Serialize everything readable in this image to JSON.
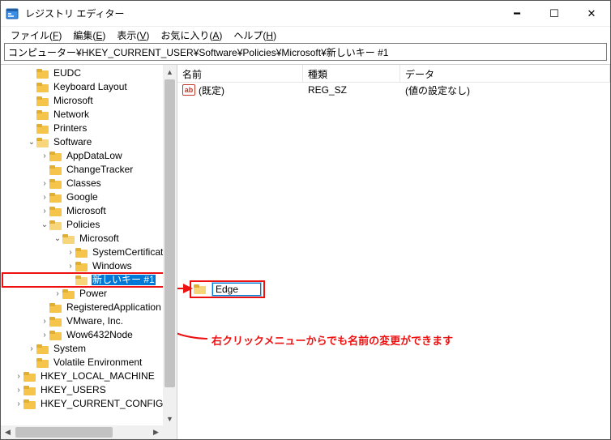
{
  "window": {
    "title": "レジストリ エディター"
  },
  "menubar": [
    {
      "label": "ファイル(F)",
      "key": "F"
    },
    {
      "label": "編集(E)",
      "key": "E"
    },
    {
      "label": "表示(V)",
      "key": "V"
    },
    {
      "label": "お気に入り(A)",
      "key": "A"
    },
    {
      "label": "ヘルプ(H)",
      "key": "H"
    }
  ],
  "path": "コンピューター¥HKEY_CURRENT_USER¥Software¥Policies¥Microsoft¥新しいキー #1",
  "list": {
    "cols": {
      "name": "名前",
      "type": "種類",
      "data": "データ"
    },
    "rows": [
      {
        "name": "(既定)",
        "type": "REG_SZ",
        "data": "(値の設定なし)"
      }
    ]
  },
  "callout": {
    "value": "Edge"
  },
  "annotation_text": "右クリックメニューからでも名前の変更ができます",
  "tree": [
    {
      "d": 0,
      "t": "none",
      "label": "EUDC"
    },
    {
      "d": 0,
      "t": "none",
      "label": "Keyboard Layout"
    },
    {
      "d": 0,
      "t": "none",
      "label": "Microsoft"
    },
    {
      "d": 0,
      "t": "none",
      "label": "Network"
    },
    {
      "d": 0,
      "t": "none",
      "label": "Printers"
    },
    {
      "d": 0,
      "t": "open",
      "label": "Software"
    },
    {
      "d": 1,
      "t": "closed",
      "label": "AppDataLow"
    },
    {
      "d": 1,
      "t": "none",
      "label": "ChangeTracker"
    },
    {
      "d": 1,
      "t": "closed",
      "label": "Classes"
    },
    {
      "d": 1,
      "t": "closed",
      "label": "Google"
    },
    {
      "d": 1,
      "t": "closed",
      "label": "Microsoft"
    },
    {
      "d": 1,
      "t": "open",
      "label": "Policies"
    },
    {
      "d": 2,
      "t": "open",
      "label": "Microsoft"
    },
    {
      "d": 3,
      "t": "closed",
      "label": "SystemCertificat"
    },
    {
      "d": 3,
      "t": "closed",
      "label": "Windows"
    },
    {
      "d": 3,
      "t": "sel",
      "label": "新しいキー #1"
    },
    {
      "d": 2,
      "t": "closed",
      "label": "Power"
    },
    {
      "d": 1,
      "t": "none",
      "label": "RegisteredApplication"
    },
    {
      "d": 1,
      "t": "closed",
      "label": "VMware, Inc."
    },
    {
      "d": 1,
      "t": "closed",
      "label": "Wow6432Node"
    },
    {
      "d": 0,
      "t": "closed",
      "label": "System"
    },
    {
      "d": 0,
      "t": "none",
      "label": "Volatile Environment"
    },
    {
      "d": -1,
      "t": "closed",
      "label": "HKEY_LOCAL_MACHINE"
    },
    {
      "d": -1,
      "t": "closed",
      "label": "HKEY_USERS"
    },
    {
      "d": -1,
      "t": "closed",
      "label": "HKEY_CURRENT_CONFIG"
    }
  ]
}
